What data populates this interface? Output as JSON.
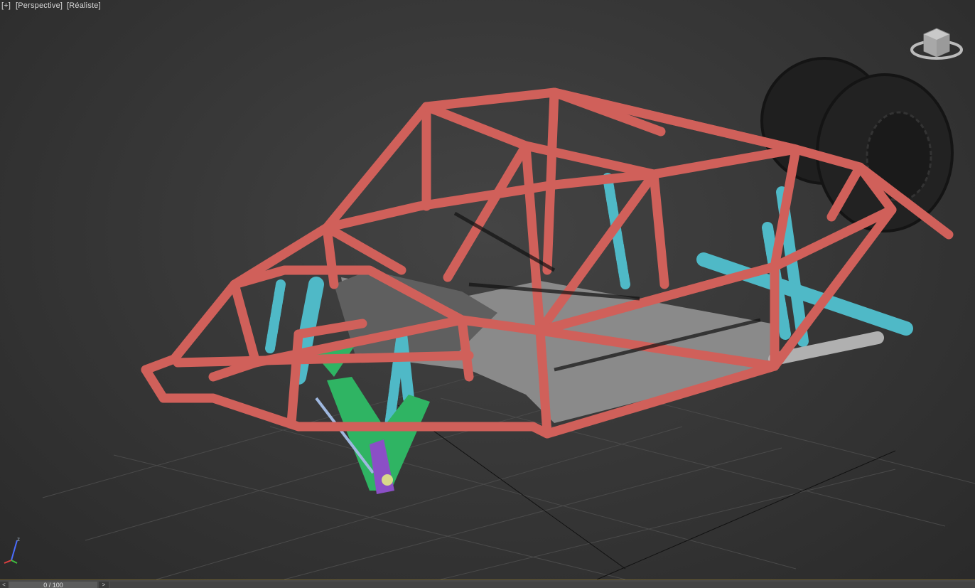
{
  "viewport": {
    "menu_label": "[+]",
    "view_label": "[Perspective]",
    "shading_label": "[Réaliste]",
    "background_color": "#3a3a3a"
  },
  "viewcube": {
    "icon": "viewcube-icon"
  },
  "axis": {
    "z_label": "z"
  },
  "scene": {
    "frame_color": "#d0605a",
    "shock_color": "#4fb9c7",
    "arm_color": "#2fb463",
    "hub_color": "#8b4fc6",
    "tire_color": "#1e1e1e",
    "floor_color": "#8e8e8e"
  },
  "timeline": {
    "prev_label": "<",
    "slider_label": "0 / 100",
    "next_label": ">"
  }
}
